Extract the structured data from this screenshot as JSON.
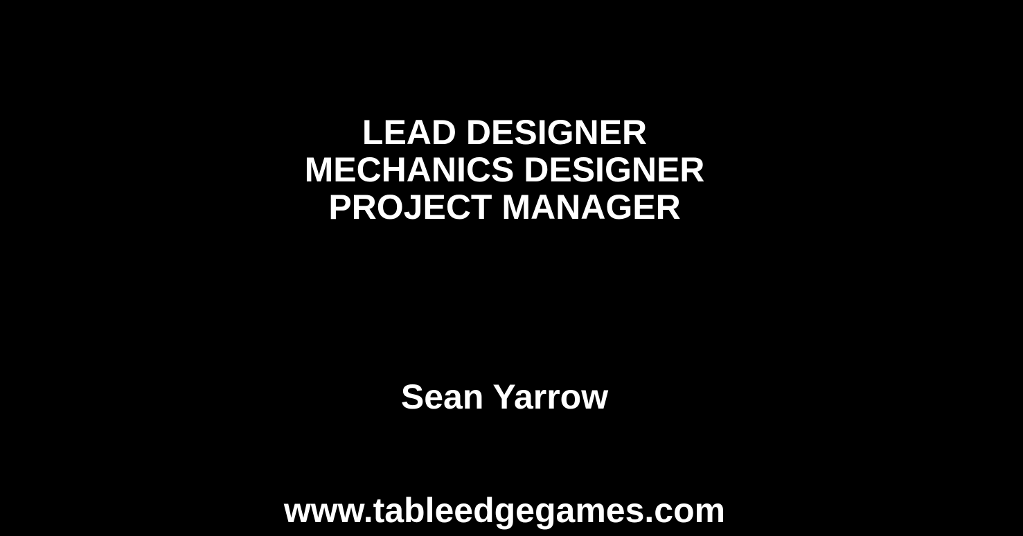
{
  "credits": {
    "roles": [
      "LEAD DESIGNER",
      "MECHANICS DESIGNER",
      "PROJECT MANAGER"
    ],
    "person_name": "Sean Yarrow",
    "website": "www.tableedgegames.com"
  },
  "colors": {
    "background": "#000000",
    "text": "#ffffff"
  }
}
